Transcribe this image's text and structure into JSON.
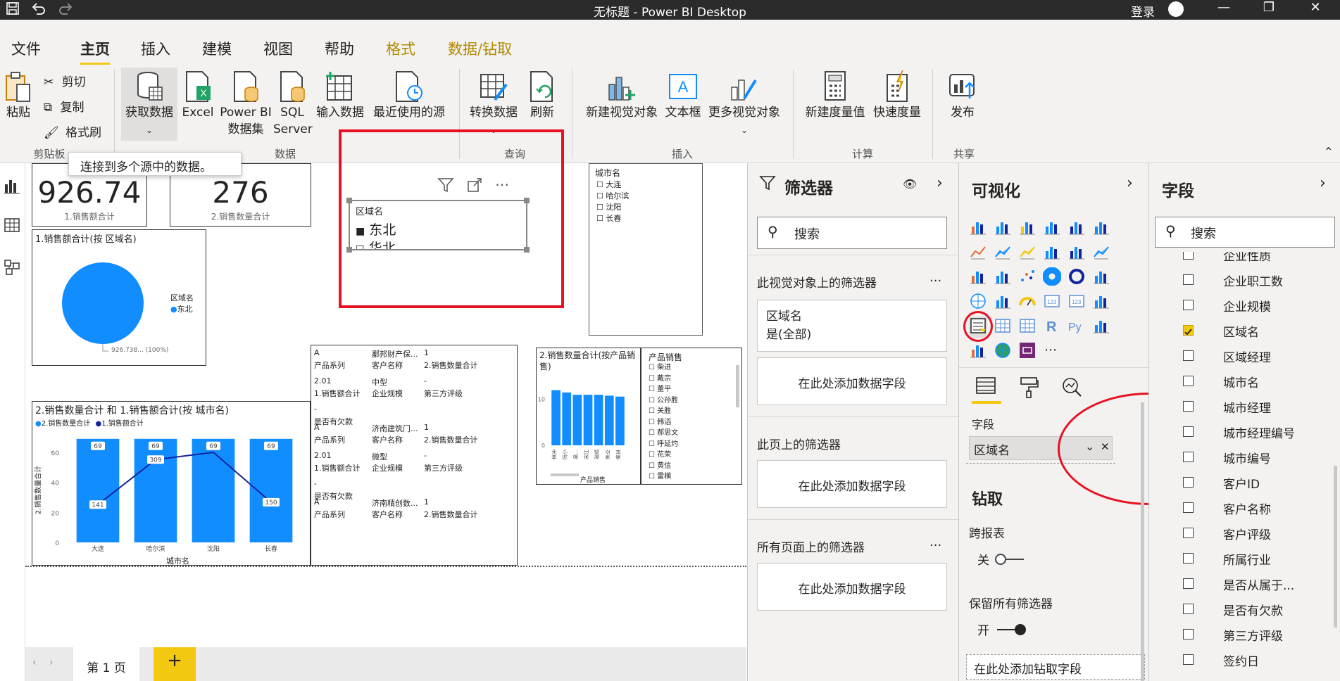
{
  "titlebar": {
    "title": "无标题 - Power BI Desktop",
    "login": "登录",
    "save_icon": "save-icon",
    "undo_icon": "undo-icon",
    "redo_icon": "redo-icon",
    "minimize": "—",
    "maximize": "❐",
    "close": "✕"
  },
  "tabs": [
    {
      "label": "文件"
    },
    {
      "label": "主页"
    },
    {
      "label": "插入"
    },
    {
      "label": "建模"
    },
    {
      "label": "视图"
    },
    {
      "label": "帮助"
    },
    {
      "label": "格式"
    },
    {
      "label": "数据/钻取"
    }
  ],
  "ribbon": {
    "paste": "粘贴",
    "cut": "剪切",
    "copy": "复制",
    "format_painter": "格式刷",
    "clipboard_group": "剪贴板",
    "get_data": "获取数据",
    "excel": "Excel",
    "pbi_dataset_1": "Power BI",
    "pbi_dataset_2": "数据集",
    "sql_1": "SQL",
    "sql_2": "Server",
    "enter_data": "输入数据",
    "recent_sources": "最近使用的源",
    "data_group": "数据",
    "transform": "转换数据",
    "refresh": "刷新",
    "query_group": "查询",
    "new_visual": "新建视觉对象",
    "text_box": "文本框",
    "more_visuals": "更多视觉对象",
    "insert_group": "插入",
    "new_measure": "新建度量值",
    "quick_measure": "快速度量",
    "calc_group": "计算",
    "publish": "发布",
    "share_group": "共享",
    "tooltip": "连接到多个源中的数据。"
  },
  "canvas": {
    "card1": {
      "value": "926.74",
      "label": "1.销售额合计"
    },
    "card2": {
      "value": "276",
      "label": "2.销售数量合计"
    },
    "slicer": {
      "title": "区域名",
      "item1": "东北",
      "item2": "华北"
    },
    "city_slicer": {
      "title": "城市名",
      "items": [
        "大连",
        "哈尔滨",
        "沈阳",
        "长春"
      ]
    },
    "pie": {
      "title": "1.销售额合计(按 区域名)",
      "legend_title": "区域名",
      "legend_item": "东北",
      "data_label": "926.738... (100%)"
    },
    "combo": {
      "title": "2.销售数量合计 和 1.销售额合计(按 城市名)",
      "legend1": "2.销售数量合计",
      "legend2": "1.销售额合计",
      "ylabel": "2.销售数量合计",
      "xlabel": "城市名"
    },
    "table": {
      "records": [
        {
          "c1a": "A",
          "c1b": "产品系列",
          "c2a": "鄱邦财产保...",
          "c2b": "客户名称",
          "c3a": "1",
          "c3b": "2.销售数量合计",
          "c1c": "2.01",
          "c1d": "1.销售额合计",
          "c2c": "中型",
          "c2d": "企业规模",
          "c3c": "-",
          "c3d": "第三方评级",
          "c1e": "-",
          "c1f": "是否有欠款"
        },
        {
          "c1a": "A",
          "c1b": "产品系列",
          "c2a": "济南建筑门...",
          "c2b": "客户名称",
          "c3a": "1",
          "c3b": "2.销售数量合计",
          "c1c": "2.01",
          "c1d": "1.销售额合计",
          "c2c": "微型",
          "c2d": "企业规模",
          "c3c": "-",
          "c3d": "第三方评级",
          "c1e": "-",
          "c1f": "是否有欠款"
        },
        {
          "c1a": "A",
          "c1b": "产品系列",
          "c2a": "济南精创数...",
          "c2b": "客户名称",
          "c3a": "1",
          "c3b": "2.销售数量合计"
        }
      ]
    },
    "small_bar": {
      "title": "2.销售数量合计(按产品销售)",
      "xlabel": "产品销售"
    },
    "product_slicer": {
      "title": "产品销售",
      "items": [
        "柴进",
        "戴宗",
        "董平",
        "公孙胜",
        "关胜",
        "韩滔",
        "郝思文",
        "呼延灼",
        "花荣",
        "黄信",
        "雷横"
      ]
    },
    "page_tab": "第 1 页",
    "add_page": "+"
  },
  "chart_data": [
    {
      "type": "bar",
      "title": "2.销售数量合计 和 1.销售额合计(按 城市名)",
      "categories": [
        "大连",
        "哈尔滨",
        "沈阳",
        "长春"
      ],
      "series": [
        {
          "name": "2.销售数量合计",
          "values": [
            69,
            69,
            69,
            69
          ],
          "kind": "bar",
          "color": "#118dff"
        },
        {
          "name": "1.销售额合计",
          "values": [
            141,
            309,
            336,
            150
          ],
          "kind": "line",
          "color": "#12239e"
        }
      ],
      "line_labels": [
        "141",
        "309",
        "",
        "150"
      ],
      "y_ticks": [
        "0",
        "20",
        "40",
        "60"
      ],
      "ylim": [
        0,
        75
      ],
      "xlabel": "城市名",
      "ylabel": "2.销售数量合计"
    },
    {
      "type": "bar",
      "title": "2.销售数量合计(按产品销售)",
      "categories": [
        "林冲",
        "阮小",
        "吴...",
        "宋江",
        "张顺",
        "朱仝",
        "柴进"
      ],
      "values": [
        12,
        11.5,
        11,
        11,
        11,
        10.8,
        10.6
      ],
      "y_ticks": [
        "0",
        "10"
      ],
      "ylim": [
        0,
        15
      ],
      "xlabel": "产品销售",
      "color": "#118dff"
    },
    {
      "type": "pie",
      "title": "1.销售额合计(按 区域名)",
      "categories": [
        "东北"
      ],
      "values": [
        926.738
      ],
      "color": "#118dff"
    }
  ],
  "filters": {
    "title": "筛选器",
    "search_placeholder": "搜索",
    "visual_filters": "此视觉对象上的筛选器",
    "field_name": "区域名",
    "field_state": "是(全部)",
    "add_field": "在此处添加数据字段",
    "page_filters": "此页上的筛选器",
    "all_pages_filters": "所有页面上的筛选器",
    "more": "..."
  },
  "viz": {
    "title": "可视化",
    "field_label": "字段",
    "field_value": "区域名",
    "drill_title": "钻取",
    "cross_report": "跨报表",
    "off_label": "关",
    "keep_filters": "保留所有筛选器",
    "on_label": "开",
    "add_drill": "在此处添加钻取字段",
    "more": "..."
  },
  "fields": {
    "title": "字段",
    "search_placeholder": "搜索",
    "items": [
      {
        "name": "企业性质",
        "checked": false
      },
      {
        "name": "企业职工数",
        "checked": false
      },
      {
        "name": "企业规模",
        "checked": false
      },
      {
        "name": "区域名",
        "checked": true
      },
      {
        "name": "区域经理",
        "checked": false
      },
      {
        "name": "城市名",
        "checked": false
      },
      {
        "name": "城市经理",
        "checked": false
      },
      {
        "name": "城市经理编号",
        "checked": false
      },
      {
        "name": "城市编号",
        "checked": false
      },
      {
        "name": "客户ID",
        "checked": false
      },
      {
        "name": "客户名称",
        "checked": false
      },
      {
        "name": "客户评级",
        "checked": false
      },
      {
        "name": "所属行业",
        "checked": false
      },
      {
        "name": "是否从属于...",
        "checked": false
      },
      {
        "name": "是否有欠款",
        "checked": false
      },
      {
        "name": "第三方评级",
        "checked": false
      },
      {
        "name": "签约日",
        "checked": false
      }
    ]
  }
}
